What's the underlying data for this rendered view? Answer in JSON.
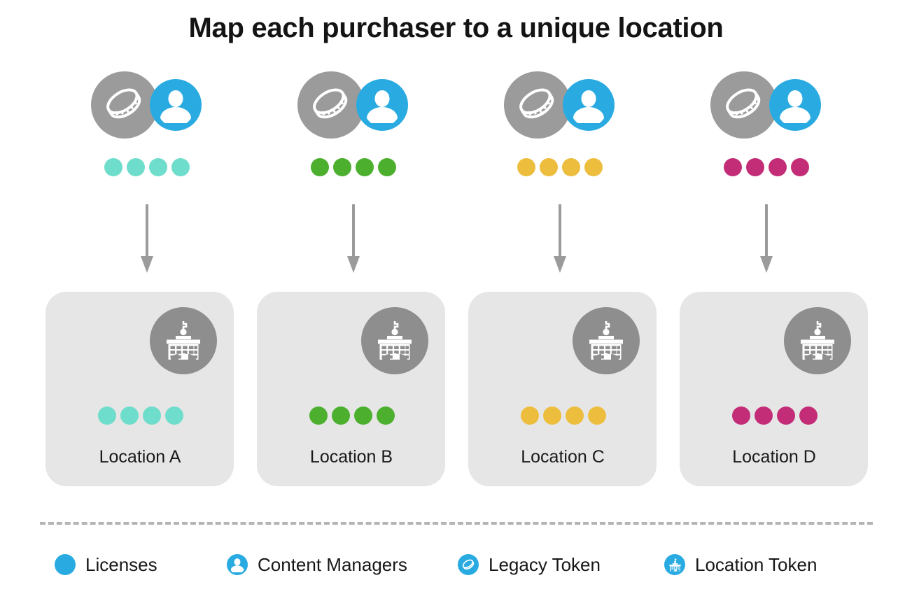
{
  "title": "Map each purchaser to a unique location",
  "colors": {
    "license_teal": "#6FDDCB",
    "license_green": "#4CAF2E",
    "license_yellow": "#EDBE3D",
    "license_magenta": "#C32D78",
    "brand_blue": "#29ABE2",
    "token_gray": "#9B9B9B",
    "building_gray": "#8E8E8E",
    "card_gray": "#E6E6E6",
    "divider_gray": "#B4B4B4",
    "arrow_gray": "#9B9B9B"
  },
  "purchasers": [
    {
      "legacy_token_icon": "legacy-token-icon",
      "content_manager_icon": "content-manager-icon",
      "license_count": 4,
      "license_color": "#6FDDCB"
    },
    {
      "legacy_token_icon": "legacy-token-icon",
      "content_manager_icon": "content-manager-icon",
      "license_count": 4,
      "license_color": "#4CAF2E"
    },
    {
      "legacy_token_icon": "legacy-token-icon",
      "content_manager_icon": "content-manager-icon",
      "license_count": 4,
      "license_color": "#EDBE3D"
    },
    {
      "legacy_token_icon": "legacy-token-icon",
      "content_manager_icon": "content-manager-icon",
      "license_count": 4,
      "license_color": "#C32D78"
    }
  ],
  "arrows": [
    {
      "direction": "down"
    },
    {
      "direction": "down"
    },
    {
      "direction": "down"
    },
    {
      "direction": "down"
    }
  ],
  "locations": [
    {
      "label": "Location A",
      "location_token_icon": "location-token-icon",
      "license_count": 4,
      "license_color": "#6FDDCB"
    },
    {
      "label": "Location B",
      "location_token_icon": "location-token-icon",
      "license_count": 4,
      "license_color": "#4CAF2E"
    },
    {
      "label": "Location C",
      "location_token_icon": "location-token-icon",
      "license_count": 4,
      "license_color": "#EDBE3D"
    },
    {
      "label": "Location D",
      "location_token_icon": "location-token-icon",
      "license_count": 4,
      "license_color": "#C32D78"
    }
  ],
  "legend": [
    {
      "label": "Licenses",
      "icon": "filled-circle-icon"
    },
    {
      "label": "Content Managers",
      "icon": "content-manager-icon"
    },
    {
      "label": "Legacy Token",
      "icon": "legacy-token-icon"
    },
    {
      "label": "Location Token",
      "icon": "location-token-icon"
    }
  ]
}
